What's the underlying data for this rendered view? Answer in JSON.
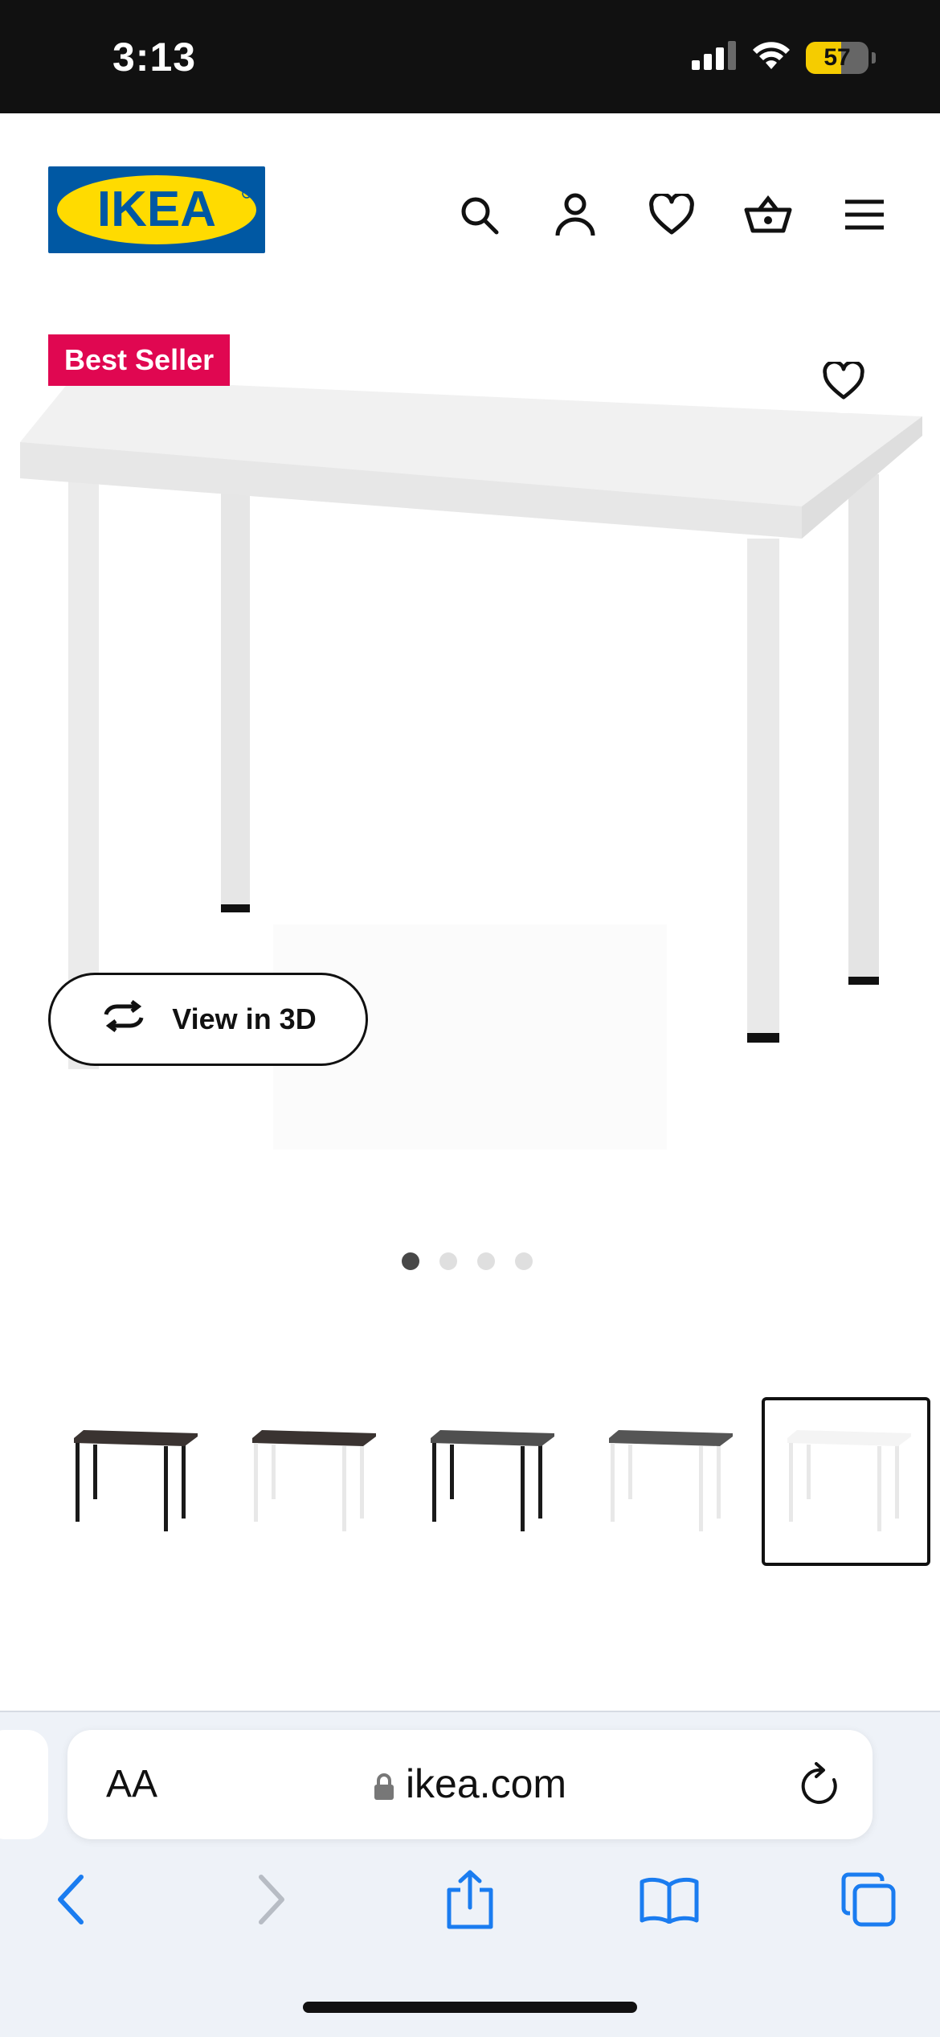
{
  "status_bar": {
    "time": "3:13",
    "battery_percent": "57",
    "battery_level": 0.57,
    "icons": [
      "signal-icon",
      "wifi-icon",
      "battery-icon"
    ]
  },
  "header": {
    "logo_text": "IKEA",
    "brand_colors": {
      "blue": "#0058a3",
      "yellow": "#ffdb00"
    },
    "icons": [
      "search-icon",
      "account-icon",
      "heart-icon",
      "cart-icon",
      "menu-icon"
    ]
  },
  "product": {
    "badge": "Best Seller",
    "badge_color": "#e00751",
    "view_3d_label": "View in 3D",
    "image_count": 4,
    "active_image": 1
  },
  "variants": [
    {
      "name": "black-brown top, black legs",
      "top": "#3a3331",
      "legs": "#1a1a1a",
      "selected": false
    },
    {
      "name": "black-brown top, white legs",
      "top": "#3a3331",
      "legs": "#e8e8e8",
      "selected": false
    },
    {
      "name": "dark grey top, black legs",
      "top": "#4f4f4f",
      "legs": "#1a1a1a",
      "selected": false
    },
    {
      "name": "dark grey top, white legs",
      "top": "#555555",
      "legs": "#e8e8e8",
      "selected": false
    },
    {
      "name": "white top, white legs",
      "top": "#f4f4f4",
      "legs": "#e8e8e8",
      "selected": true
    }
  ],
  "browser": {
    "text_size_label": "AA",
    "url": "ikea.com",
    "accent": "#1a7cf0",
    "toolbar_icons": [
      "back-icon",
      "forward-icon",
      "share-icon",
      "bookmarks-icon",
      "tabs-icon"
    ]
  }
}
